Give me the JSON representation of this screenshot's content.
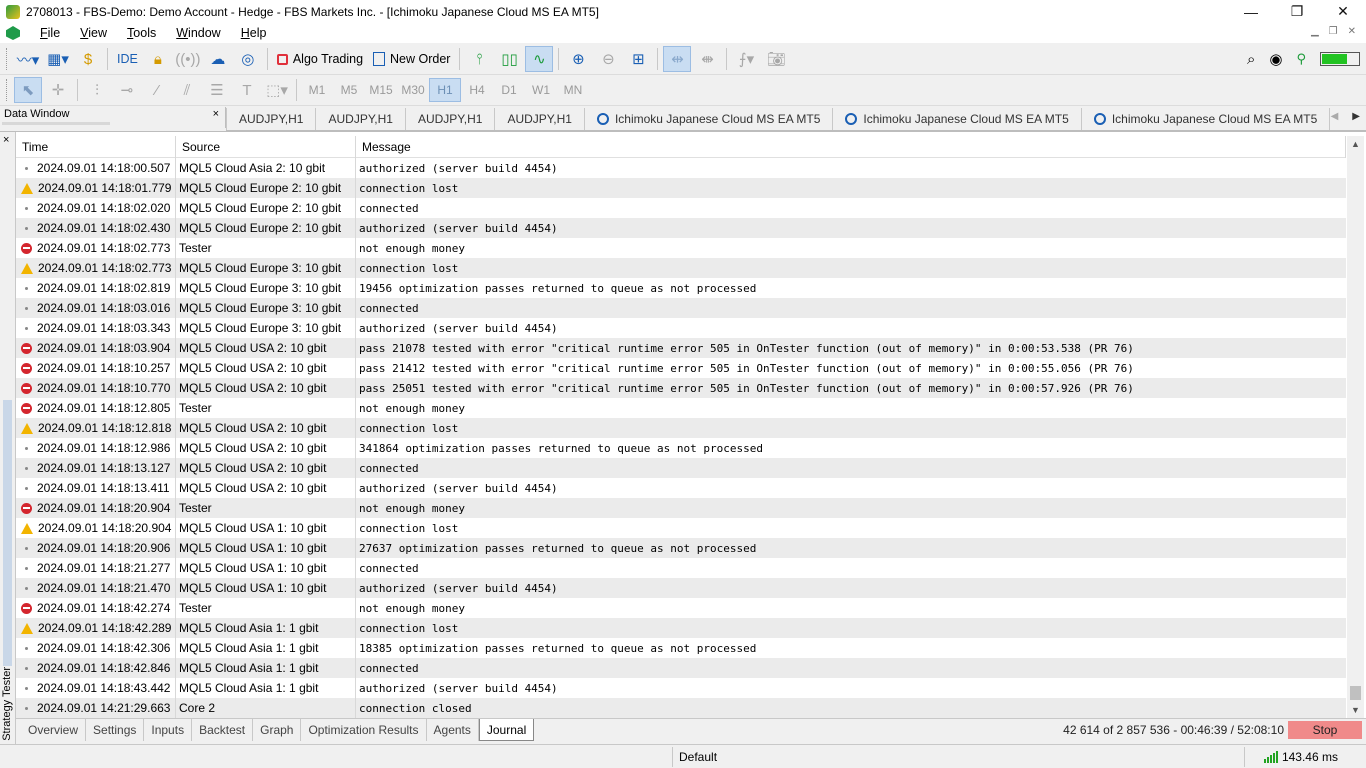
{
  "window": {
    "title": "2708013 - FBS-Demo: Demo Account - Hedge - FBS Markets Inc. - [Ichimoku Japanese Cloud MS EA MT5]",
    "minimize": "—",
    "maximize": "❐",
    "close": "✕"
  },
  "menu": {
    "items": [
      {
        "u": "F",
        "rest": "ile"
      },
      {
        "u": "V",
        "rest": "iew"
      },
      {
        "u": "T",
        "rest": "ools"
      },
      {
        "u": "W",
        "rest": "indow"
      },
      {
        "u": "H",
        "rest": "elp"
      }
    ]
  },
  "toolbar": {
    "ide_label": "IDE",
    "algo_trading_label": "Algo Trading",
    "new_order_label": "New Order"
  },
  "timeframes": [
    "M1",
    "M5",
    "M15",
    "M30",
    "H1",
    "H4",
    "D1",
    "W1",
    "MN"
  ],
  "active_timeframe": "H1",
  "data_window": {
    "title": "Data Window",
    "close": "×"
  },
  "chart_tabs": [
    {
      "label": "AUDJPY,H1",
      "icon": false
    },
    {
      "label": "AUDJPY,H1",
      "icon": false
    },
    {
      "label": "AUDJPY,H1",
      "icon": false
    },
    {
      "label": "AUDJPY,H1",
      "icon": false
    },
    {
      "label": "Ichimoku Japanese Cloud MS EA MT5",
      "icon": true
    },
    {
      "label": "Ichimoku Japanese Cloud MS EA MT5",
      "icon": true
    },
    {
      "label": "Ichimoku Japanese Cloud MS EA MT5",
      "icon": true
    }
  ],
  "tester": {
    "side_label": "Strategy Tester",
    "close": "×",
    "columns": {
      "time": "Time",
      "source": "Source",
      "message": "Message"
    },
    "rows": [
      {
        "level": "info",
        "time": "2024.09.01 14:18:00.507",
        "source": "MQL5 Cloud Asia 2: 10 gbit",
        "message": "authorized (server build 4454)"
      },
      {
        "level": "warn",
        "time": "2024.09.01 14:18:01.779",
        "source": "MQL5 Cloud Europe 2: 10 gbit",
        "message": "connection lost"
      },
      {
        "level": "info",
        "time": "2024.09.01 14:18:02.020",
        "source": "MQL5 Cloud Europe 2: 10 gbit",
        "message": "connected"
      },
      {
        "level": "info",
        "time": "2024.09.01 14:18:02.430",
        "source": "MQL5 Cloud Europe 2: 10 gbit",
        "message": "authorized (server build 4454)"
      },
      {
        "level": "err",
        "time": "2024.09.01 14:18:02.773",
        "source": "Tester",
        "message": "not enough money"
      },
      {
        "level": "warn",
        "time": "2024.09.01 14:18:02.773",
        "source": "MQL5 Cloud Europe 3: 10 gbit",
        "message": "connection lost"
      },
      {
        "level": "info",
        "time": "2024.09.01 14:18:02.819",
        "source": "MQL5 Cloud Europe 3: 10 gbit",
        "message": "19456 optimization passes returned to queue as not processed"
      },
      {
        "level": "info",
        "time": "2024.09.01 14:18:03.016",
        "source": "MQL5 Cloud Europe 3: 10 gbit",
        "message": "connected"
      },
      {
        "level": "info",
        "time": "2024.09.01 14:18:03.343",
        "source": "MQL5 Cloud Europe 3: 10 gbit",
        "message": "authorized (server build 4454)"
      },
      {
        "level": "err",
        "time": "2024.09.01 14:18:03.904",
        "source": "MQL5 Cloud USA 2: 10 gbit",
        "message": "pass 21078 tested with error \"critical runtime error 505 in OnTester function (out of memory)\" in 0:00:53.538 (PR 76)"
      },
      {
        "level": "err",
        "time": "2024.09.01 14:18:10.257",
        "source": "MQL5 Cloud USA 2: 10 gbit",
        "message": "pass 21412 tested with error \"critical runtime error 505 in OnTester function (out of memory)\" in 0:00:55.056 (PR 76)"
      },
      {
        "level": "err",
        "time": "2024.09.01 14:18:10.770",
        "source": "MQL5 Cloud USA 2: 10 gbit",
        "message": "pass 25051 tested with error \"critical runtime error 505 in OnTester function (out of memory)\" in 0:00:57.926 (PR 76)"
      },
      {
        "level": "err",
        "time": "2024.09.01 14:18:12.805",
        "source": "Tester",
        "message": "not enough money"
      },
      {
        "level": "warn",
        "time": "2024.09.01 14:18:12.818",
        "source": "MQL5 Cloud USA 2: 10 gbit",
        "message": "connection lost"
      },
      {
        "level": "info",
        "time": "2024.09.01 14:18:12.986",
        "source": "MQL5 Cloud USA 2: 10 gbit",
        "message": "341864 optimization passes returned to queue as not processed"
      },
      {
        "level": "info",
        "time": "2024.09.01 14:18:13.127",
        "source": "MQL5 Cloud USA 2: 10 gbit",
        "message": "connected"
      },
      {
        "level": "info",
        "time": "2024.09.01 14:18:13.411",
        "source": "MQL5 Cloud USA 2: 10 gbit",
        "message": "authorized (server build 4454)"
      },
      {
        "level": "err",
        "time": "2024.09.01 14:18:20.904",
        "source": "Tester",
        "message": "not enough money"
      },
      {
        "level": "warn",
        "time": "2024.09.01 14:18:20.904",
        "source": "MQL5 Cloud USA 1: 10 gbit",
        "message": "connection lost"
      },
      {
        "level": "info",
        "time": "2024.09.01 14:18:20.906",
        "source": "MQL5 Cloud USA 1: 10 gbit",
        "message": "27637 optimization passes returned to queue as not processed"
      },
      {
        "level": "info",
        "time": "2024.09.01 14:18:21.277",
        "source": "MQL5 Cloud USA 1: 10 gbit",
        "message": "connected"
      },
      {
        "level": "info",
        "time": "2024.09.01 14:18:21.470",
        "source": "MQL5 Cloud USA 1: 10 gbit",
        "message": "authorized (server build 4454)"
      },
      {
        "level": "err",
        "time": "2024.09.01 14:18:42.274",
        "source": "Tester",
        "message": "not enough money"
      },
      {
        "level": "warn",
        "time": "2024.09.01 14:18:42.289",
        "source": "MQL5 Cloud Asia 1: 1 gbit",
        "message": "connection lost"
      },
      {
        "level": "info",
        "time": "2024.09.01 14:18:42.306",
        "source": "MQL5 Cloud Asia 1: 1 gbit",
        "message": "18385 optimization passes returned to queue as not processed"
      },
      {
        "level": "info",
        "time": "2024.09.01 14:18:42.846",
        "source": "MQL5 Cloud Asia 1: 1 gbit",
        "message": "connected"
      },
      {
        "level": "info",
        "time": "2024.09.01 14:18:43.442",
        "source": "MQL5 Cloud Asia 1: 1 gbit",
        "message": "authorized (server build 4454)"
      },
      {
        "level": "info",
        "time": "2024.09.01 14:21:29.663",
        "source": "Core 2",
        "message": "connection closed"
      }
    ],
    "tabs": [
      "Overview",
      "Settings",
      "Inputs",
      "Backtest",
      "Graph",
      "Optimization Results",
      "Agents",
      "Journal"
    ],
    "active_tab": "Journal",
    "progress": "42 614 of 2 857 536  -  00:46:39 / 52:08:10",
    "stop_label": "Stop"
  },
  "status": {
    "profile": "Default",
    "ping": "143.46 ms"
  },
  "colors": {
    "error": "#d4262e",
    "warning": "#f2b400",
    "active_button": "#c9ddf2",
    "stop_button": "#f08a8a",
    "connection": "#22c322"
  }
}
